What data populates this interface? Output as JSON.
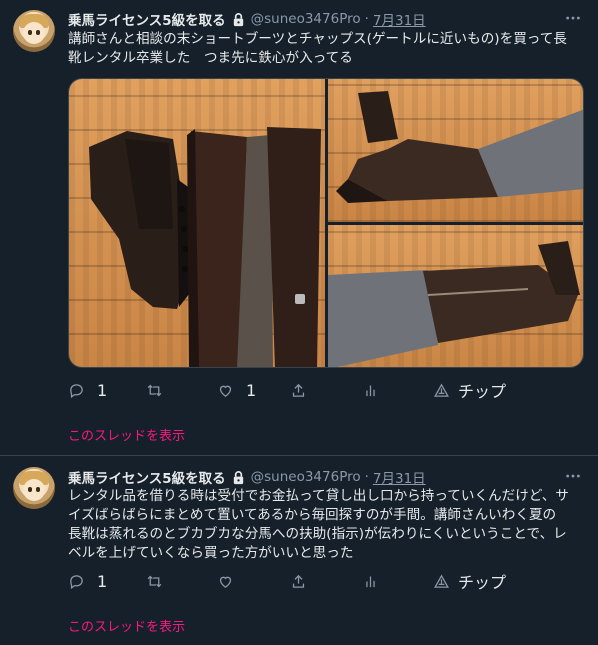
{
  "tweets": [
    {
      "author_name": "乗馬ライセンス5級を取る",
      "handle": "@suneo3476Pro",
      "separator": "·",
      "date": "7月31日",
      "text_lines": [
        "講師さんと相談の末ショートブーツとチャップス(ゲートルに近いもの)を買って長",
        "靴レンタル卒業した　つま先に鉄心が入ってる"
      ],
      "reply_count": "1",
      "retweet_count": "",
      "like_count": "1",
      "tip_label": "チップ",
      "show_thread": "このスレッドを表示",
      "media": [
        {
          "icon": "photo-boots-and-chaps"
        },
        {
          "icon": "photo-boot-worn-side"
        },
        {
          "icon": "photo-boot-worn-zipper"
        }
      ]
    },
    {
      "author_name": "乗馬ライセンス5級を取る",
      "handle": "@suneo3476Pro",
      "separator": "·",
      "date": "7月31日",
      "text_lines": [
        "レンタル品を借りる時は受付でお金払って貸し出し口から持っていくんだけど、サ",
        "イズばらばらにまとめて置いてあるから毎回探すのが手間。講師さんいわく夏の",
        "長靴は蒸れるのとブカブカな分馬への扶助(指示)が伝わりにくいということで、レ",
        "ベルを上げていくなら買った方がいいと思った"
      ],
      "reply_count": "1",
      "retweet_count": "",
      "like_count": "",
      "tip_label": "チップ",
      "show_thread": "このスレッドを表示"
    }
  ],
  "colors": {
    "background": "#15202b",
    "text": "#e7e9ea",
    "muted": "#8b98a5",
    "link": "#f91880",
    "border": "#38444d"
  }
}
